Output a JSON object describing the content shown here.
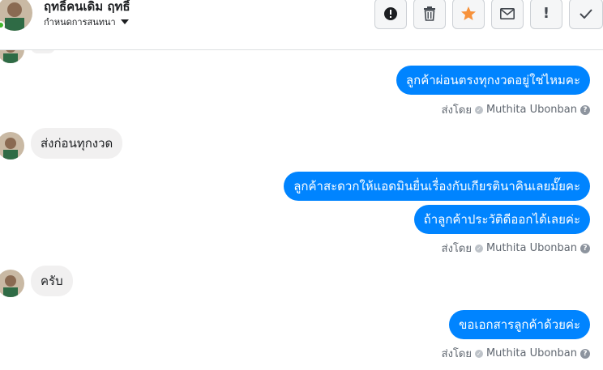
{
  "header": {
    "contact_name": "ฤทธิ์คนเดิม ฤทธิ์",
    "label_dropdown": "กำหนดการสนทนา"
  },
  "toolbar": {
    "buttons": [
      {
        "icon": "alert-circle-icon",
        "glyph": "!"
      },
      {
        "icon": "trash-icon",
        "glyph": ""
      },
      {
        "icon": "star-icon",
        "glyph": "★",
        "color": "#f7923b"
      },
      {
        "icon": "envelope-icon",
        "glyph": "✉"
      },
      {
        "icon": "exclamation-icon",
        "glyph": "!"
      },
      {
        "icon": "check-icon",
        "glyph": "✓"
      }
    ]
  },
  "messages": [
    {
      "direction": "out",
      "text": "ลูกค้าผ่อนตรงทุกงวดอยู่ใช่ไหมคะ"
    },
    {
      "direction": "in",
      "text": "ส่งก่อนทุกงวด"
    },
    {
      "direction": "out",
      "text": "ลูกค้าสะดวกให้แอดมินยื่นเรื่องกับเกียรตินาคินเลยมั๊ยคะ"
    },
    {
      "direction": "out",
      "text": "ถ้าลูกค้าประวัติดีออกได้เลยค่ะ"
    },
    {
      "direction": "in",
      "text": "ครับ"
    },
    {
      "direction": "out",
      "text": "ขอเอกสารลูกค้าด้วยค่ะ"
    }
  ],
  "sent_by": {
    "prefix": "ส่งโดย",
    "agent": "Muthita Ubonban"
  },
  "colors": {
    "outgoing_bubble": "#0084ff",
    "incoming_bubble": "#f1f0f0",
    "star_icon": "#f7923b"
  }
}
